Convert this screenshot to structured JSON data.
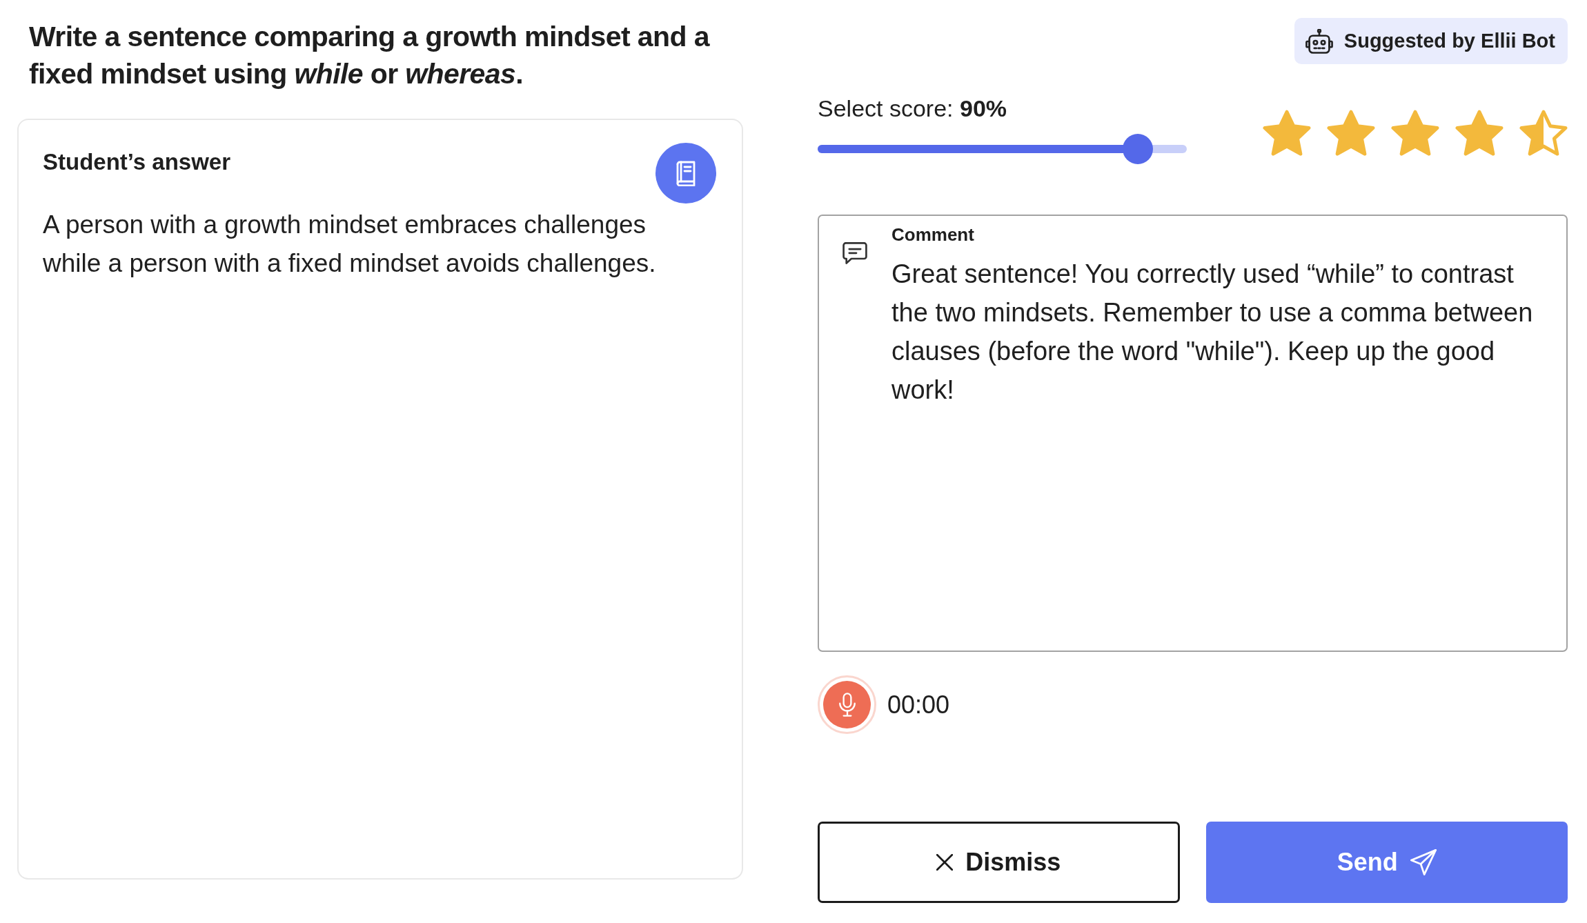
{
  "prompt": "Write a sentence comparing a growth mindset and a fixed mindset using *while* or *whereas*.",
  "suggestion_badge": {
    "label": "Suggested by Ellii Bot"
  },
  "answer_card": {
    "title": "Student’s answer",
    "text": "A person with a growth mindset embraces challenges while a person with a fixed mindset avoids challenges."
  },
  "score": {
    "label": "Select score: **90%**",
    "level": 0.9,
    "stars": 4.5
  },
  "comment": {
    "label": "Comment",
    "value": "Great sentence! You correctly used “while” to contrast the two mindsets. Remember to use a comma between clauses (before the word \"while\"). Keep up the good work!"
  },
  "recorder": {
    "time": "00:00"
  },
  "buttons": [
    {
      "kind": "dismiss",
      "label": "Dismiss"
    },
    {
      "kind": "send",
      "label": "Send"
    }
  ]
}
